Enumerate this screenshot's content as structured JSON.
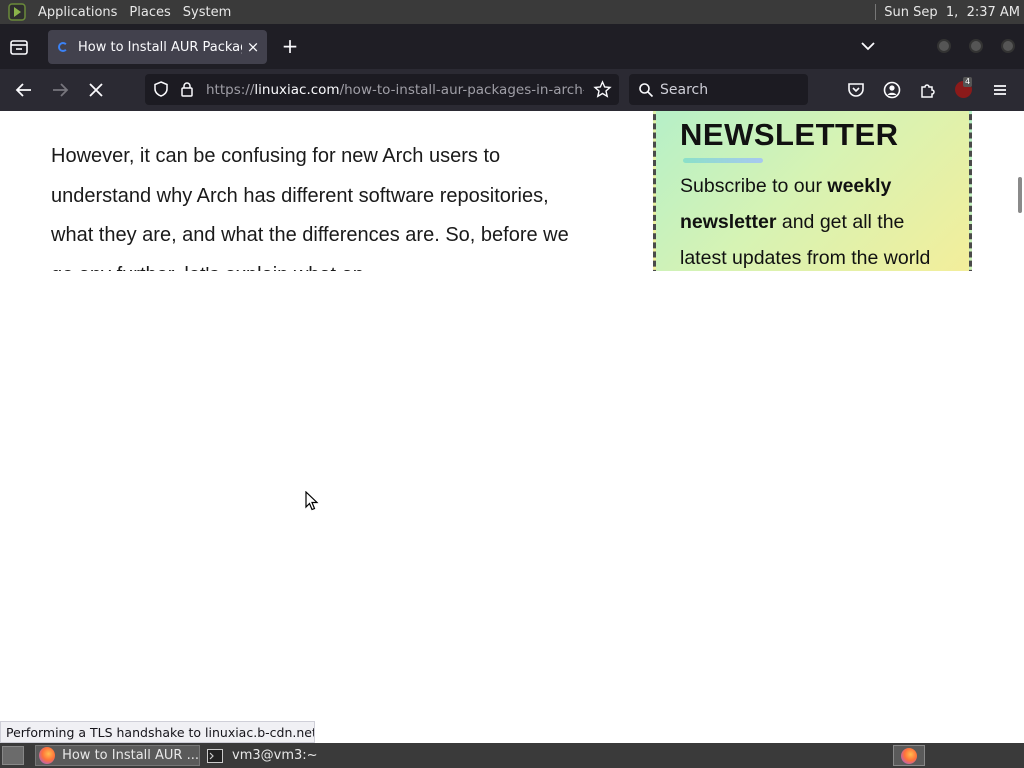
{
  "top_panel": {
    "menus": [
      "Applications",
      "Places",
      "System"
    ],
    "clock": "Sun Sep  1,  2:37 AM"
  },
  "browser": {
    "tab": {
      "title": "How to Install AUR Package",
      "close": "×"
    },
    "new_tab": "+",
    "url": {
      "scheme": "https://",
      "host": "linuxiac.com",
      "path": "/how-to-install-aur-packages-in-arch-linux"
    },
    "search_placeholder": "Search",
    "extension_badge": "4"
  },
  "page": {
    "article_text": "However, it can be confusing for new Arch users to understand why Arch has different software repositories, what they are, and what the differences are. So, before we go any further, let's explain what an",
    "newsletter": {
      "heading": "NEWSLETTER",
      "text_before": "Subscribe to our ",
      "text_bold": "weekly newsletter",
      "text_after": " and get all the latest updates from the world"
    }
  },
  "status_text": "Performing a TLS handshake to linuxiac.b-cdn.net…",
  "taskbar": {
    "tasks": [
      {
        "label": "How to Install AUR ..."
      },
      {
        "label": "vm3@vm3:~"
      }
    ]
  },
  "colors": {
    "panel": "#3a3a3a",
    "tabbar": "#1f1e25",
    "navbar": "#2b2a33",
    "accent": "#3b82f6"
  }
}
